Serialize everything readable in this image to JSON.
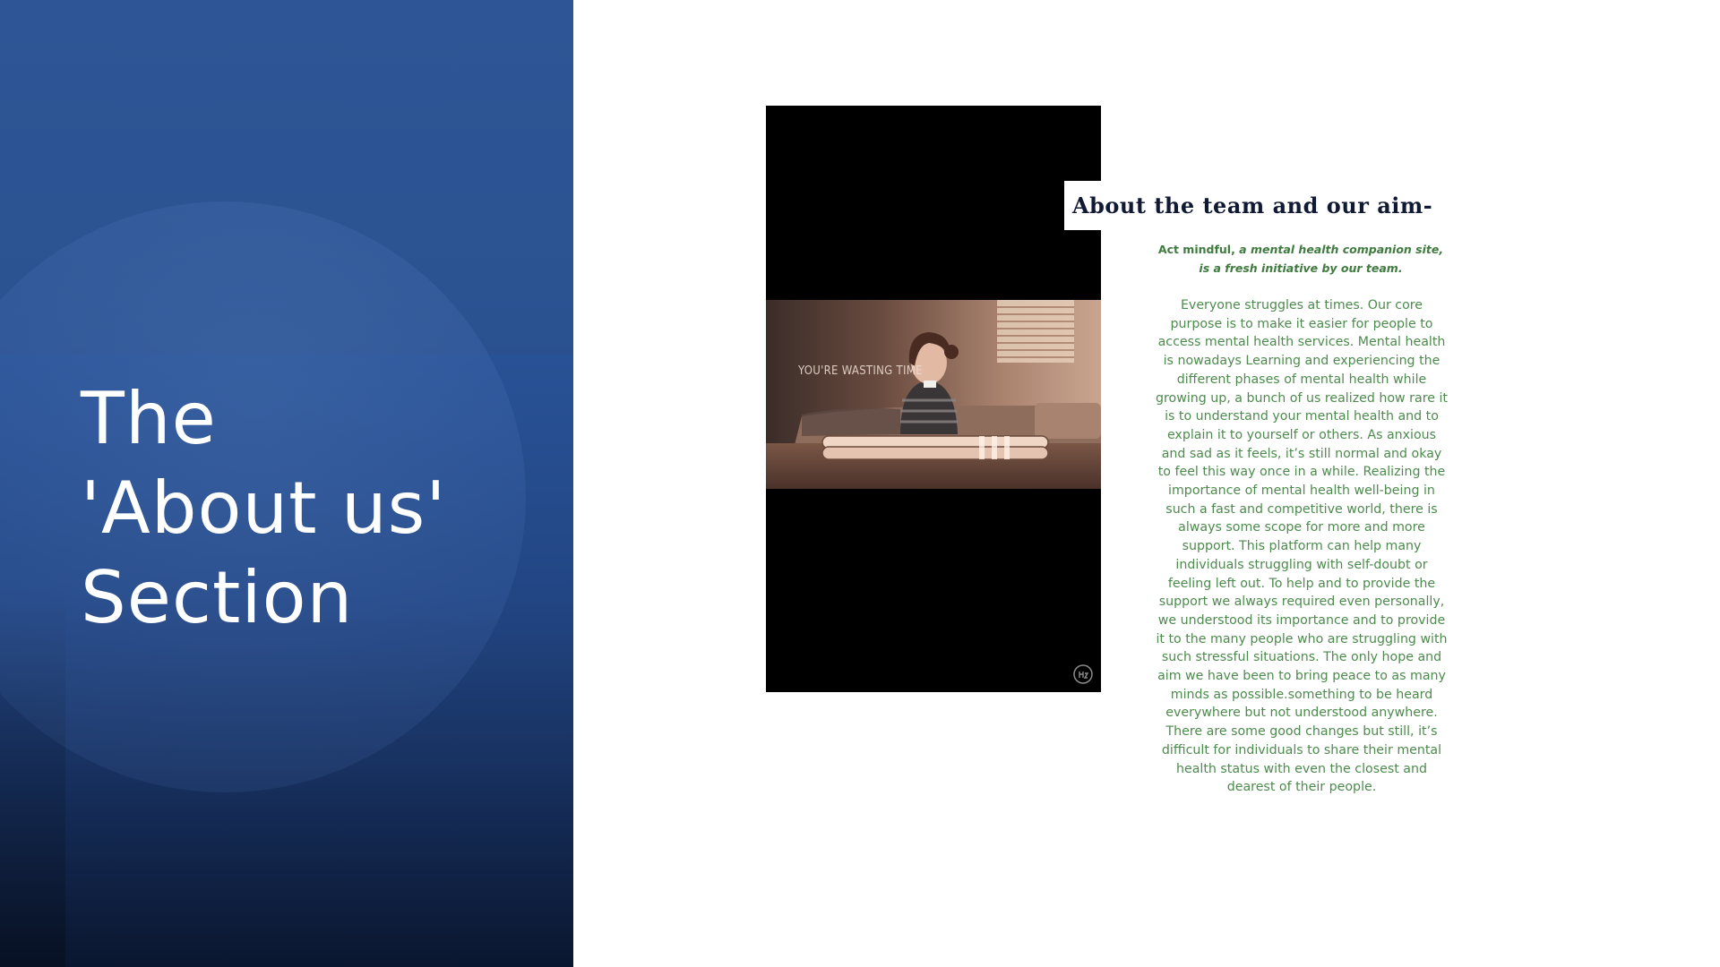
{
  "slide": {
    "title_lines": [
      "The",
      "'About us'",
      "Section"
    ]
  },
  "video": {
    "caption": "YOU'RE WASTING TIME",
    "watermark_icon": "circular-logo-icon"
  },
  "about": {
    "heading": "About the team and our aim-",
    "intro_bold": "Act mindful,",
    "intro_italic": " a mental health companion site, is a fresh initiative by our team.",
    "body": "Everyone struggles at times. Our core purpose is to make it easier for people to access mental health services. Mental health is nowadays Learning and experiencing the different phases of mental health while growing up, a bunch of us realized how rare it is to understand your mental health and to explain it to yourself or others. As anxious and sad as it feels, it’s still normal and okay to feel this way once in a while. Realizing the importance of mental health well-being in such a fast and competitive world, there is always some scope for more and more support. This platform can help many individuals struggling with self-doubt or feeling left out. To help and to provide the support we always required even personally, we understood its importance and to provide it to the many people who are struggling with such stressful situations. The only hope and aim we have been to bring peace to as many minds as possible.something to be heard everywhere but not understood anywhere. There are some good changes but still, it’s difficult for individuals to share their mental health status with even the closest and dearest of their people."
  },
  "colors": {
    "panel_blue": "#2b5392",
    "heading_text": "#111a33",
    "body_green": "#4d8a4d"
  }
}
